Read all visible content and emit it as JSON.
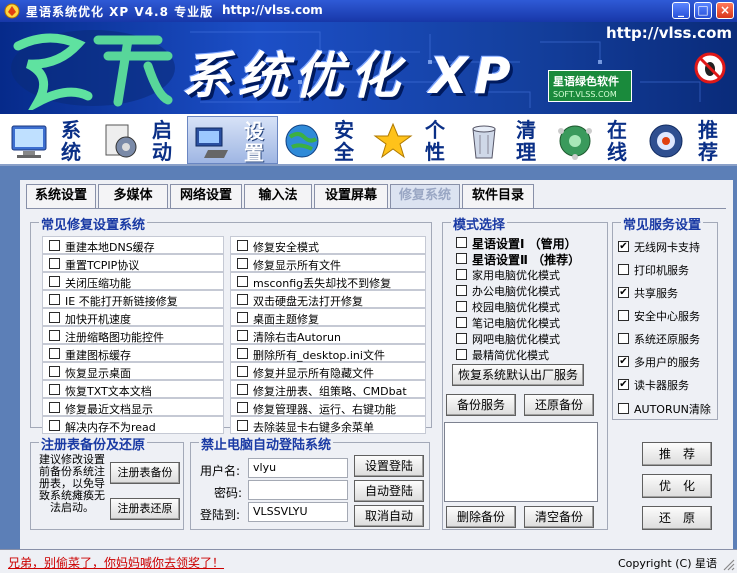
{
  "window": {
    "title": "星语系统优化 XP V4.8 专业版",
    "url": "http://vlss.com",
    "minimize": "_",
    "maximize": "□",
    "close": "×"
  },
  "banner": {
    "big_title": "系统优化 XP",
    "site_url": "http://vlss.com",
    "badge_line1": "星语绿色软件",
    "badge_line2": "SOFT.VLSS.COM"
  },
  "categories": [
    {
      "label": "系统",
      "icon": "monitor-icon"
    },
    {
      "label": "启动",
      "icon": "startup-icon"
    },
    {
      "label": "设置",
      "icon": "settings-icon"
    },
    {
      "label": "安全",
      "icon": "globe-shield-icon"
    },
    {
      "label": "个性",
      "icon": "star-icon"
    },
    {
      "label": "清理",
      "icon": "trash-icon"
    },
    {
      "label": "在线",
      "icon": "network-globe-icon"
    },
    {
      "label": "推荐",
      "icon": "recommend-icon"
    }
  ],
  "active_category": "设置",
  "tabs": [
    "系统设置",
    "多媒体",
    "网络设置",
    "输入法",
    "设置屏幕",
    "修复系统",
    "软件目录"
  ],
  "active_tab": "修复系统",
  "repair": {
    "title": "常见修复设置系统",
    "left": [
      "重建本地DNS缓存",
      "重置TCPIP协议",
      "关闭压缩功能",
      "IE 不能打开新链接修复",
      "加快开机速度",
      "注册缩略图功能控件",
      "重建图标缓存",
      "恢复显示桌面",
      "恢复TXT文本文档",
      "修复最近文档显示",
      "解决内存不为read"
    ],
    "right": [
      "修复安全模式",
      "修复显示所有文件",
      "msconfig丢失却找不到修复",
      "双击硬盘无法打开修复",
      "桌面主题修复",
      "清除右击Autorun",
      "删除所有_desktop.ini文件",
      "修复并显示所有隐藏文件",
      "修复注册表、组策略、CMDbat",
      "修复管理器、运行、右键功能",
      "去除装显卡右键多余菜单"
    ]
  },
  "mode": {
    "title": "模式选择",
    "items": [
      {
        "label": "星语设置Ⅰ （管用）",
        "bold": true
      },
      {
        "label": "星语设置Ⅱ （推荐）",
        "bold": true
      },
      {
        "label": "家用电脑优化模式",
        "bold": false
      },
      {
        "label": "办公电脑优化模式",
        "bold": false
      },
      {
        "label": "校园电脑优化模式",
        "bold": false
      },
      {
        "label": "笔记电脑优化模式",
        "bold": false
      },
      {
        "label": "网吧电脑优化模式",
        "bold": false
      },
      {
        "label": "最精简优化模式",
        "bold": false
      }
    ],
    "restore_default": "恢复系统默认出厂服务",
    "backup_service": "备份服务",
    "restore_backup": "还原备份",
    "delete_backup": "删除备份",
    "clear_backup": "清空备份"
  },
  "services": {
    "title": "常见服务设置",
    "items": [
      {
        "label": "无线网卡支持",
        "checked": true
      },
      {
        "label": "打印机服务",
        "checked": false
      },
      {
        "label": "共享服务",
        "checked": true
      },
      {
        "label": "安全中心服务",
        "checked": false
      },
      {
        "label": "系统还原服务",
        "checked": false
      },
      {
        "label": "多用户的服务",
        "checked": true
      },
      {
        "label": "读卡器服务",
        "checked": true
      },
      {
        "label": "AUTORUN清除",
        "checked": false
      }
    ]
  },
  "side_buttons": {
    "recommend": "推　荐",
    "optimize": "优　化",
    "restore": "还　原"
  },
  "registry": {
    "title": "注册表备份及还原",
    "hint": "建议修改设置前备份系统注册表，以免导致系统瘫痪无法启动。",
    "backup": "注册表备份",
    "restore": "注册表还原"
  },
  "autologin": {
    "title": "禁止电脑自动登陆系统",
    "user_label": "用户名:",
    "user_value": "vlyu",
    "pwd_label": "密码:",
    "pwd_value": "",
    "domain_label": "登陆到:",
    "domain_value": "VLSSVLYU",
    "set_login": "设置登陆",
    "auto_login": "自动登陆",
    "cancel_auto": "取消自动"
  },
  "status": {
    "link": "兄弟，别偷菜了，你妈妈喊你去领奖了！",
    "copyright": "Copyright (C) 星语"
  },
  "colors": {
    "accent": "#1a3aa4",
    "link": "#cc0000",
    "banner": "#1c4fc7"
  }
}
